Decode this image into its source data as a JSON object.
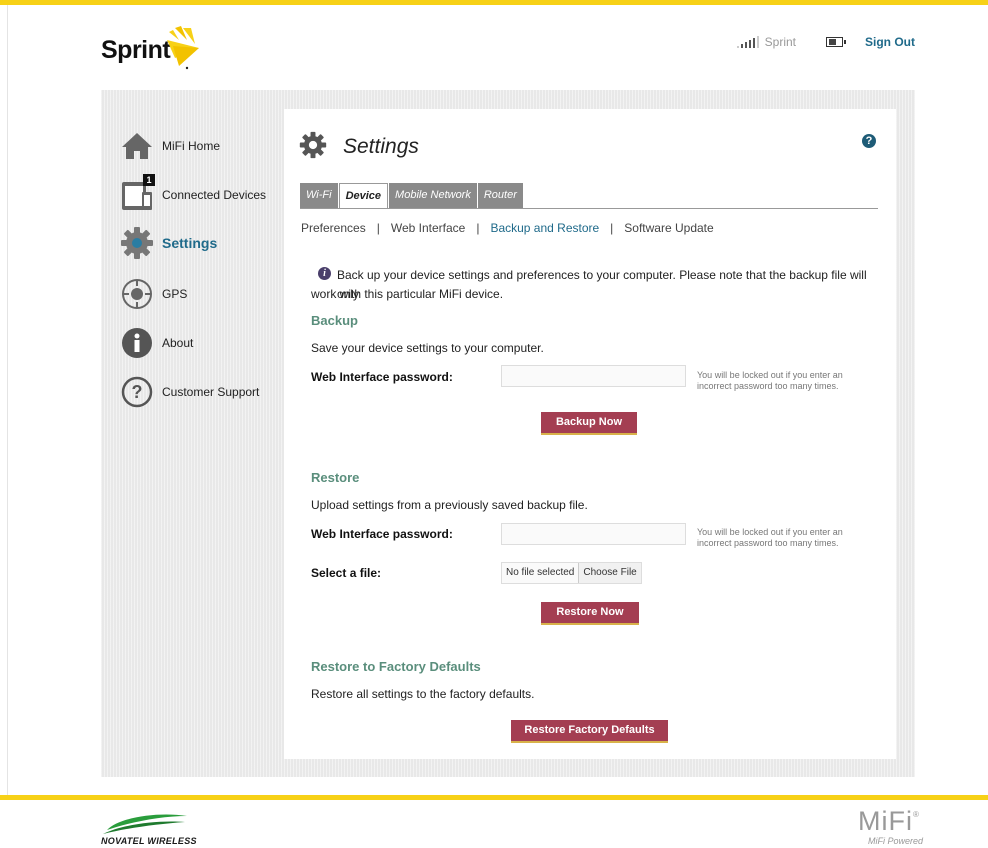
{
  "header": {
    "logo_text": "Sprint",
    "carrier": "Sprint",
    "sign_out": "Sign Out"
  },
  "sidebar": {
    "items": [
      {
        "label": "MiFi Home",
        "icon": "home-icon"
      },
      {
        "label": "Connected Devices",
        "icon": "devices-icon",
        "badge": "1"
      },
      {
        "label": "Settings",
        "icon": "gear-icon",
        "active": true
      },
      {
        "label": "GPS",
        "icon": "gps-icon"
      },
      {
        "label": "About",
        "icon": "info-icon"
      },
      {
        "label": "Customer Support",
        "icon": "question-icon"
      }
    ]
  },
  "page": {
    "title": "Settings",
    "help": "?"
  },
  "tabs": [
    {
      "label": "Wi-Fi"
    },
    {
      "label": "Device",
      "active": true
    },
    {
      "label": "Mobile Network"
    },
    {
      "label": "Router"
    }
  ],
  "subnav": [
    {
      "label": "Preferences"
    },
    {
      "label": "Web Interface"
    },
    {
      "label": "Backup and Restore",
      "active": true
    },
    {
      "label": "Software Update"
    }
  ],
  "info": {
    "line1": "Back up your device settings and preferences to your computer. Please note that the backup file will only",
    "line2": "work with this particular MiFi device."
  },
  "backup": {
    "heading": "Backup",
    "description": "Save your device settings to your computer.",
    "password_label": "Web Interface password:",
    "password_value": "",
    "note": "You will be locked out if you enter an incorrect password too many times.",
    "button": "Backup Now"
  },
  "restore": {
    "heading": "Restore",
    "description": "Upload settings from a previously saved backup file.",
    "password_label": "Web Interface password:",
    "password_value": "",
    "note": "You will be locked out if you enter an incorrect password too many times.",
    "file_label": "Select a file:",
    "file_status": "No file selected",
    "file_button": "Choose File",
    "button": "Restore Now"
  },
  "factory": {
    "heading": "Restore to Factory Defaults",
    "description": "Restore all settings to the factory defaults.",
    "button": "Restore Factory Defaults"
  },
  "footer": {
    "novatel": "NOVATEL WIRELESS",
    "mifi": "MiFi",
    "mifi_reg": "®",
    "mifi_sub": "MiFi Powered"
  },
  "colors": {
    "accent_yellow": "#f7d117",
    "link_blue": "#1f6a8a",
    "section_green": "#5a8e7c",
    "button_red": "#a43e52"
  }
}
